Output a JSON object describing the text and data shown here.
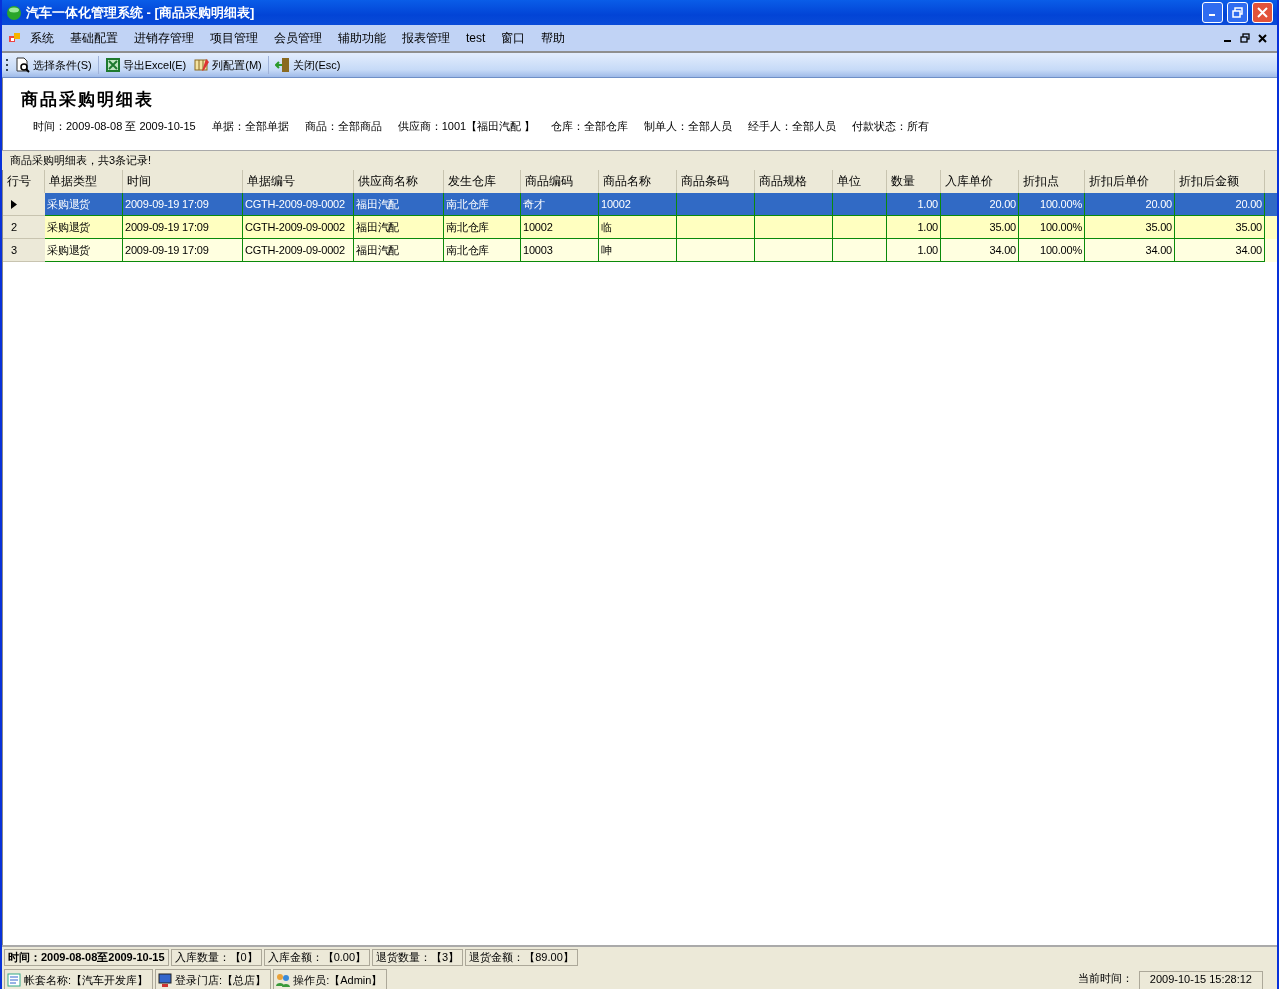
{
  "window": {
    "title": "汽车一体化管理系统 - [商品采购明细表]"
  },
  "menu": [
    "系统",
    "基础配置",
    "进销存管理",
    "项目管理",
    "会员管理",
    "辅助功能",
    "报表管理",
    "test",
    "窗口",
    "帮助"
  ],
  "toolbar": [
    {
      "kind": "search",
      "label": "选择条件(S)"
    },
    {
      "kind": "excel",
      "label": "导出Excel(E)"
    },
    {
      "kind": "columns",
      "label": "列配置(M)"
    },
    {
      "kind": "exit",
      "label": "关闭(Esc)"
    }
  ],
  "report": {
    "title": "商品采购明细表",
    "filters": [
      "时间：2009-08-08 至 2009-10-15",
      "单据：全部单据",
      "商品：全部商品",
      "供应商：1001【福田汽配 】",
      "仓库：全部仓库",
      "制单人：全部人员",
      "经手人：全部人员",
      "付款状态：所有"
    ]
  },
  "caption": "商品采购明细表，共3条记录!",
  "table": {
    "columns": [
      {
        "label": "行号",
        "kind": "row_header"
      },
      {
        "label": "单据类型",
        "kind": "text"
      },
      {
        "label": "时间",
        "kind": "text"
      },
      {
        "label": "单据编号",
        "kind": "text"
      },
      {
        "label": "供应商名称",
        "kind": "text"
      },
      {
        "label": "发生仓库",
        "kind": "text"
      },
      {
        "label": "商品编码",
        "kind": "text"
      },
      {
        "label": "商品名称",
        "kind": "text"
      },
      {
        "label": "商品条码",
        "kind": "text"
      },
      {
        "label": "商品规格",
        "kind": "text"
      },
      {
        "label": "单位",
        "kind": "text"
      },
      {
        "label": "数量",
        "kind": "number"
      },
      {
        "label": "入库单价",
        "kind": "number"
      },
      {
        "label": "折扣点",
        "kind": "number"
      },
      {
        "label": "折扣后单价",
        "kind": "number"
      },
      {
        "label": "折扣后金额",
        "kind": "number"
      }
    ],
    "rows": [
      {
        "selected": true,
        "cells": [
          "",
          "采购退货",
          "2009-09-19 17:09",
          "CGTH-2009-09-0002",
          "福田汽配",
          "南北仓库",
          "奇才",
          "10002",
          "",
          "",
          "",
          "1.00",
          "20.00",
          "100.00%",
          "20.00",
          "20.00"
        ]
      },
      {
        "selected": false,
        "cells": [
          "2",
          "采购退货",
          "2009-09-19 17:09",
          "CGTH-2009-09-0002",
          "福田汽配",
          "南北仓库",
          "10002",
          "临",
          "",
          "",
          "",
          "1.00",
          "35.00",
          "100.00%",
          "35.00",
          "35.00"
        ]
      },
      {
        "selected": false,
        "cells": [
          "3",
          "采购退货",
          "2009-09-19 17:09",
          "CGTH-2009-09-0002",
          "福田汽配",
          "南北仓库",
          "10003",
          "呻",
          "",
          "",
          "",
          "1.00",
          "34.00",
          "100.00%",
          "34.00",
          "34.00"
        ]
      }
    ]
  },
  "summary": [
    "时间：2009-08-08至2009-10-15",
    "入库数量：【0】",
    "入库金额：【0.00】",
    "退货数量：【3】",
    "退货金额：【89.00】"
  ],
  "status_bar": {
    "items": [
      {
        "kind": "book",
        "label": "帐套名称:【汽车开发库】"
      },
      {
        "kind": "store",
        "label": "登录门店:【总店】"
      },
      {
        "kind": "users",
        "label": "操作员:【Admin】"
      }
    ],
    "time_label": "当前时间：",
    "time": "2009-10-15 15:28:12"
  }
}
